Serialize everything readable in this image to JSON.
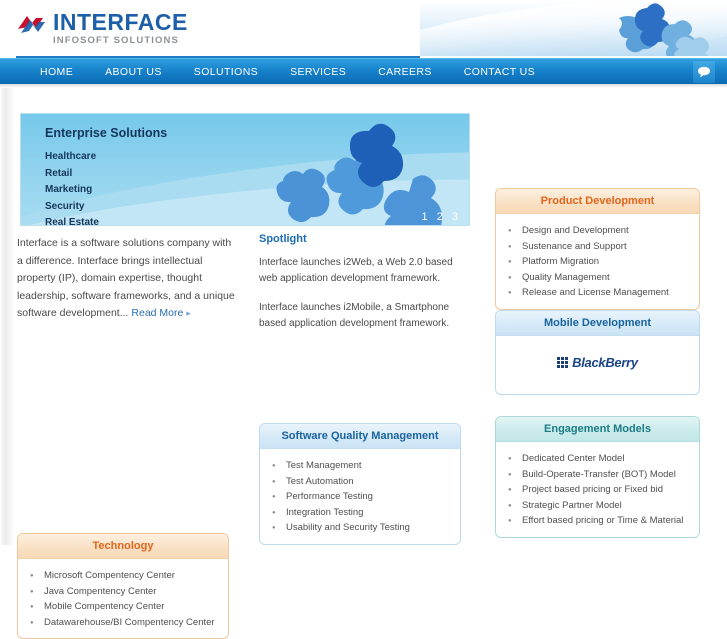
{
  "header": {
    "logo_title": "INTERFACE",
    "logo_subtitle": "INFOSOFT SOLUTIONS",
    "logo_colors": {
      "title": "#1d5fa8",
      "subtitle": "#8d9299",
      "mark_red": "#c8102e",
      "mark_blue": "#1d5fa8"
    }
  },
  "nav": {
    "items": [
      {
        "label": "HOME"
      },
      {
        "label": "ABOUT US"
      },
      {
        "label": "SOLUTIONS"
      },
      {
        "label": "SERVICES"
      },
      {
        "label": "CAREERS"
      },
      {
        "label": "CONTACT US"
      }
    ],
    "chat_icon": "chat-bubble-icon",
    "bar_color": "#1782cb"
  },
  "slider": {
    "title": "Enterprise Solutions",
    "items": [
      {
        "label": "Healthcare"
      },
      {
        "label": "Retail"
      },
      {
        "label": "Marketing"
      },
      {
        "label": "Security"
      },
      {
        "label": "Real Estate"
      }
    ],
    "pager": [
      "1",
      "2",
      "3"
    ],
    "active_page": "1"
  },
  "intro": {
    "text": "Interface is a software solutions company with a difference. Interface brings intellectual property (IP), domain expertise, thought leadership, software frameworks, and a unique software development...",
    "read_more": "Read More",
    "arrow": "▸"
  },
  "spotlight": {
    "title": "Spotlight",
    "items": [
      {
        "text": "Interface launches i2Web, a Web 2.0 based web application development framework."
      },
      {
        "text": "Interface launches i2Mobile, a Smartphone based application development framework."
      }
    ]
  },
  "panels": {
    "product_development": {
      "title": "Product Development",
      "accent": "#e2651c",
      "items": [
        {
          "label": "Design and Development"
        },
        {
          "label": "Sustenance and Support"
        },
        {
          "label": "Platform Migration"
        },
        {
          "label": "Quality Management"
        },
        {
          "label": "Release and License Management"
        }
      ]
    },
    "mobile_development": {
      "title": "Mobile Development",
      "accent": "#19639f",
      "logo_text": "BlackBerry",
      "logo_name": "blackberry-logo"
    },
    "engagement_models": {
      "title": "Engagement Models",
      "accent": "#1a7d86",
      "items": [
        {
          "label": "Dedicated Center Model"
        },
        {
          "label": "Build-Operate-Transfer (BOT) Model"
        },
        {
          "label": "Project based pricing or Fixed bid"
        },
        {
          "label": "Strategic Partner Model"
        },
        {
          "label": "Effort based pricing or Time & Material"
        }
      ]
    },
    "software_quality": {
      "title": "Software Quality Management",
      "accent": "#19639f",
      "items": [
        {
          "label": "Test Management"
        },
        {
          "label": "Test Automation"
        },
        {
          "label": "Performance Testing"
        },
        {
          "label": "Integration Testing"
        },
        {
          "label": "Usability and Security Testing"
        }
      ]
    },
    "technology": {
      "title": "Technology",
      "accent": "#e2651c",
      "items": [
        {
          "label": "Microsoft Compentency Center"
        },
        {
          "label": "Java Compentency Center"
        },
        {
          "label": "Mobile Compentency Center"
        },
        {
          "label": "Datawarehouse/BI Compentency Center"
        }
      ]
    }
  }
}
